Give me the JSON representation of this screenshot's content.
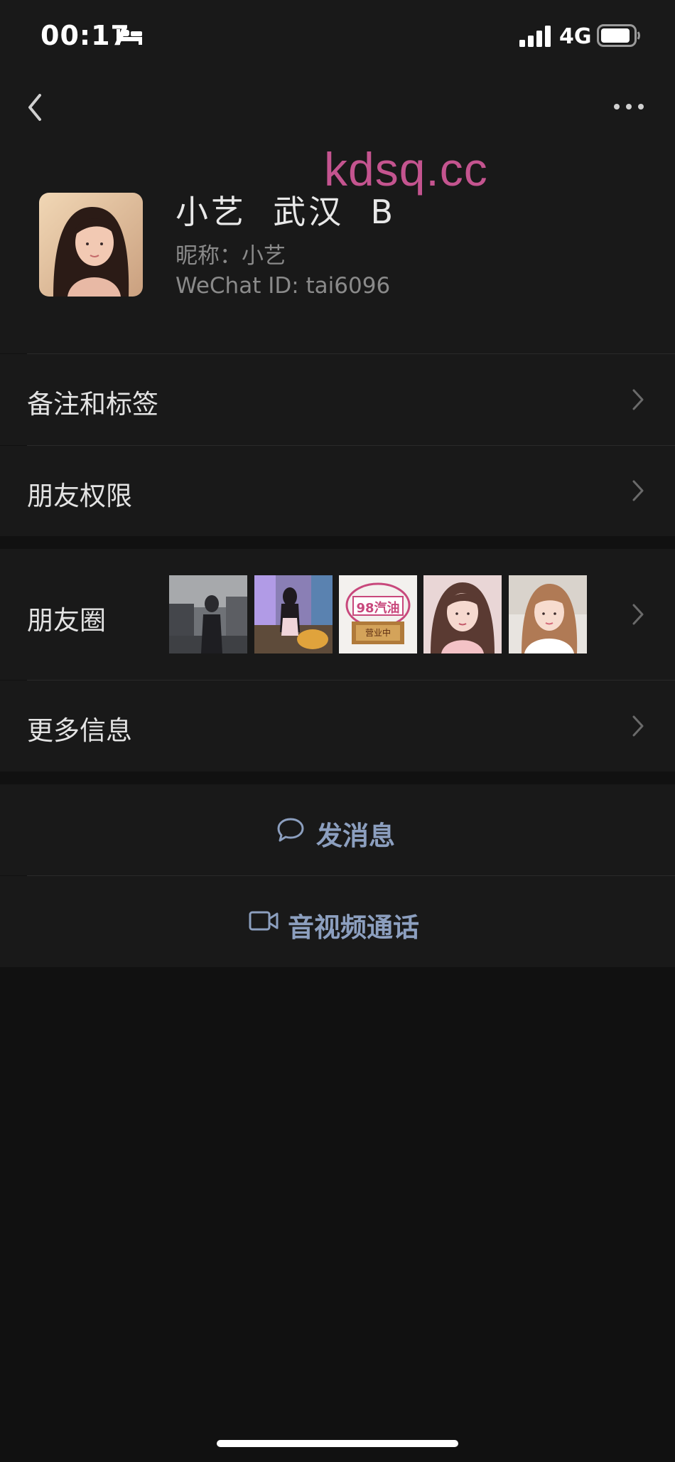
{
  "status_bar": {
    "time": "00:17",
    "network": "4G",
    "icons": [
      "bed-icon",
      "cellular-signal-icon",
      "battery-icon"
    ]
  },
  "nav": {
    "back_icon": "chevron-left-icon",
    "more_icon": "more-dots-icon"
  },
  "watermark": "kdsq.cc",
  "profile": {
    "display_name": "小艺  武汉  B",
    "nickname": "昵称：小艺",
    "wechat_id": "WeChat ID: tai6096"
  },
  "menu": {
    "notes_and_tags": "备注和标签",
    "friend_permissions": "朋友权限",
    "moments": "朋友圈",
    "more_info": "更多信息"
  },
  "moments_thumbnails": [
    {
      "id": "photo-street",
      "text": ""
    },
    {
      "id": "photo-room",
      "text": ""
    },
    {
      "id": "photo-sign",
      "text": "98汽油",
      "sub": "营业中"
    },
    {
      "id": "photo-portrait-1",
      "text": ""
    },
    {
      "id": "photo-portrait-2",
      "text": ""
    }
  ],
  "actions": {
    "send_message": "发消息",
    "video_call": "音视频通话"
  },
  "colors": {
    "background": "#111111",
    "surface": "#191919",
    "action_text": "#8c9fbf",
    "watermark": "#c4548f"
  }
}
